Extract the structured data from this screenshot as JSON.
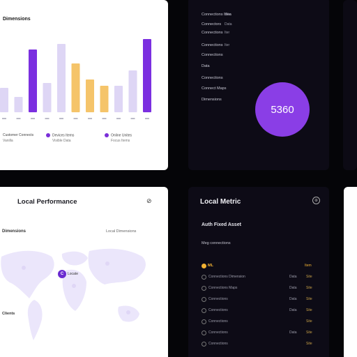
{
  "bar_card": {
    "title": "Dimensions",
    "legend": [
      {
        "label": "Customer Connects",
        "sub": "Vanilla",
        "color": "#7a2fd8"
      },
      {
        "label": "Devices Items",
        "sub": "Visible Data",
        "color": "#7a2fd8"
      },
      {
        "label": "Online Unites",
        "sub": "Focus Items",
        "color": "#7a2fd8"
      }
    ],
    "colors": {
      "dark": "#7b2fe0",
      "light": "#ded6f5",
      "orange": "#f5c46a"
    }
  },
  "chart_data": {
    "type": "bar",
    "categories": [
      "",
      "",
      "",
      "",
      "",
      "",
      "",
      "",
      "",
      "",
      "",
      ""
    ],
    "values": [
      35,
      22,
      90,
      42,
      98,
      70,
      47,
      38,
      38,
      60,
      105,
      0
    ],
    "colors": [
      "#ded6f5",
      "#ded6f5",
      "#7b2fe0",
      "#ded6f5",
      "#ded6f5",
      "#f5c46a",
      "#f5c46a",
      "#f5c46a",
      "#ded6f5",
      "#ded6f5",
      "#7b2fe0",
      "#ded6f5"
    ],
    "ylim": [
      0,
      110
    ],
    "grid": false
  },
  "list_card": {
    "items": [
      {
        "label": "Connections Idea",
        "value": "Site"
      },
      {
        "label": "Connectors",
        "value": "Data"
      },
      {
        "label": "Connections",
        "value": "Iter"
      },
      {
        "label": "Connections",
        "value": "Iter"
      },
      {
        "label": "Connections",
        "value": ""
      },
      {
        "label": "Data",
        "value": ""
      },
      {
        "label": "Connections",
        "value": ""
      },
      {
        "label": "Connect Maps",
        "value": ""
      },
      {
        "label": "Dimensions",
        "value": ""
      }
    ],
    "metric_value": "5360",
    "accent": "#8a3ee6"
  },
  "map_card": {
    "title": "Local Performance",
    "label_left": "Dimensions",
    "label_right": "Local Dimensions",
    "pin_letter": "C",
    "pin_text": "Locate",
    "label_bottom": "Clients"
  },
  "table_card": {
    "title": "Local Metric",
    "subtitle": "Auth Fixed Asset",
    "subtitle2": "Meg connections",
    "header": {
      "label": "ML",
      "value": "Item"
    },
    "rows": [
      {
        "name": "Connections Dimension",
        "a": "Data",
        "b": "Site"
      },
      {
        "name": "Connections Maps",
        "a": "Data",
        "b": "Site"
      },
      {
        "name": "Connections",
        "a": "Data",
        "b": "Site"
      },
      {
        "name": "Connections",
        "a": "Data",
        "b": "Site"
      },
      {
        "name": "Connections",
        "a": "",
        "b": "Site"
      },
      {
        "name": "Connections",
        "a": "Data",
        "b": "Site"
      },
      {
        "name": "Connections",
        "a": "",
        "b": "Site"
      }
    ]
  }
}
